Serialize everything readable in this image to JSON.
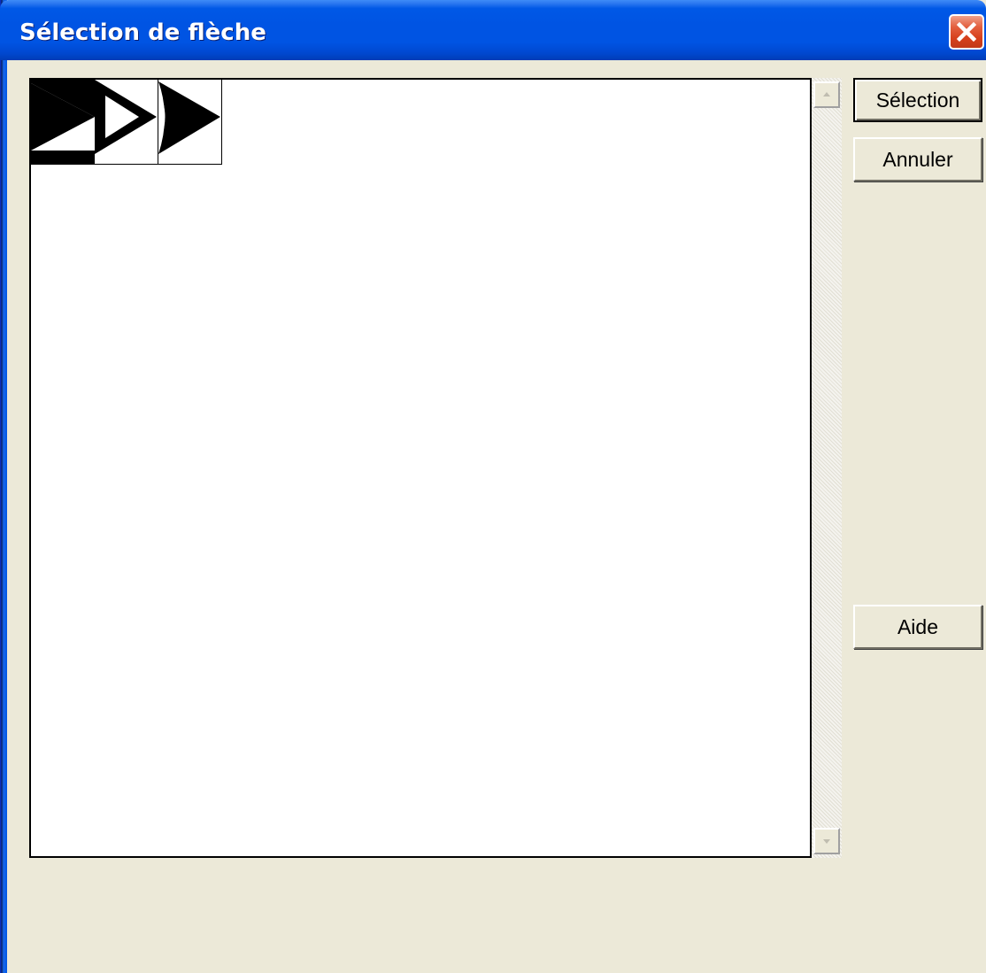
{
  "window": {
    "title": "Sélection de flèche"
  },
  "arrows": [
    {
      "name": "filled-arrow",
      "style": "filled-banner"
    },
    {
      "name": "outline-arrow",
      "style": "outlined"
    },
    {
      "name": "curved-back-arrow",
      "style": "filled-curved"
    }
  ],
  "buttons": {
    "select_label": "Sélection",
    "cancel_label": "Annuler",
    "help_label": "Aide"
  },
  "colors": {
    "title_bar": "#0054E3",
    "close_button": "#D6401C",
    "dialog_bg": "#ECE9D8"
  }
}
